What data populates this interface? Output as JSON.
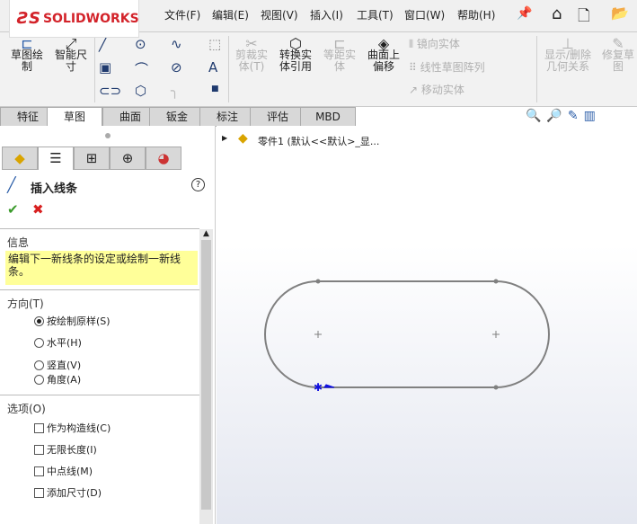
{
  "app": {
    "logo_text": "SOLIDWORKS",
    "logo_prefix": "DS"
  },
  "menu": [
    "文件(F)",
    "编辑(E)",
    "视图(V)",
    "插入(I)",
    "工具(T)",
    "窗口(W)",
    "帮助(H)"
  ],
  "toolbar": {
    "sketch": "草图绘制",
    "smart_dim": "智能尺寸",
    "trim": "剪裁实体(T)",
    "convert": "转换实体引用",
    "offset": "等距实体",
    "offset_surface": "曲面上偏移",
    "mirror": "镜向实体",
    "linear_pattern": "线性草图阵列",
    "move": "移动实体",
    "show_relations": "显示/删除几何关系",
    "repair": "修复草图"
  },
  "tabs": [
    {
      "label": "特征"
    },
    {
      "label": "草图",
      "active": true
    },
    {
      "label": "曲面"
    },
    {
      "label": "钣金"
    },
    {
      "label": "标注"
    },
    {
      "label": "评估"
    },
    {
      "label": "MBD"
    }
  ],
  "tree": {
    "item": "零件1 (默认<<默认>_显..."
  },
  "property": {
    "title": "插入线条",
    "info_header": "信息",
    "info_text": "编辑下一新线条的设定或绘制一新线条。",
    "direction_header": "方向(T)",
    "directions": [
      {
        "label": "按绘制原样(S)",
        "selected": true
      },
      {
        "label": "水平(H)"
      },
      {
        "label": "竖直(V)"
      },
      {
        "label": "角度(A)"
      }
    ],
    "options_header": "选项(O)",
    "options": [
      {
        "label": "作为构造线(C)",
        "checked": false
      },
      {
        "label": "无限长度(I)",
        "checked": false
      },
      {
        "label": "中点线(M)",
        "checked": false
      },
      {
        "label": "添加尺寸(D)",
        "checked": false
      }
    ]
  },
  "colors": {
    "accent": "#d3232a",
    "info_bg": "#ffff99",
    "sketch_line": "#808080",
    "endpoint": "#1010e0"
  }
}
